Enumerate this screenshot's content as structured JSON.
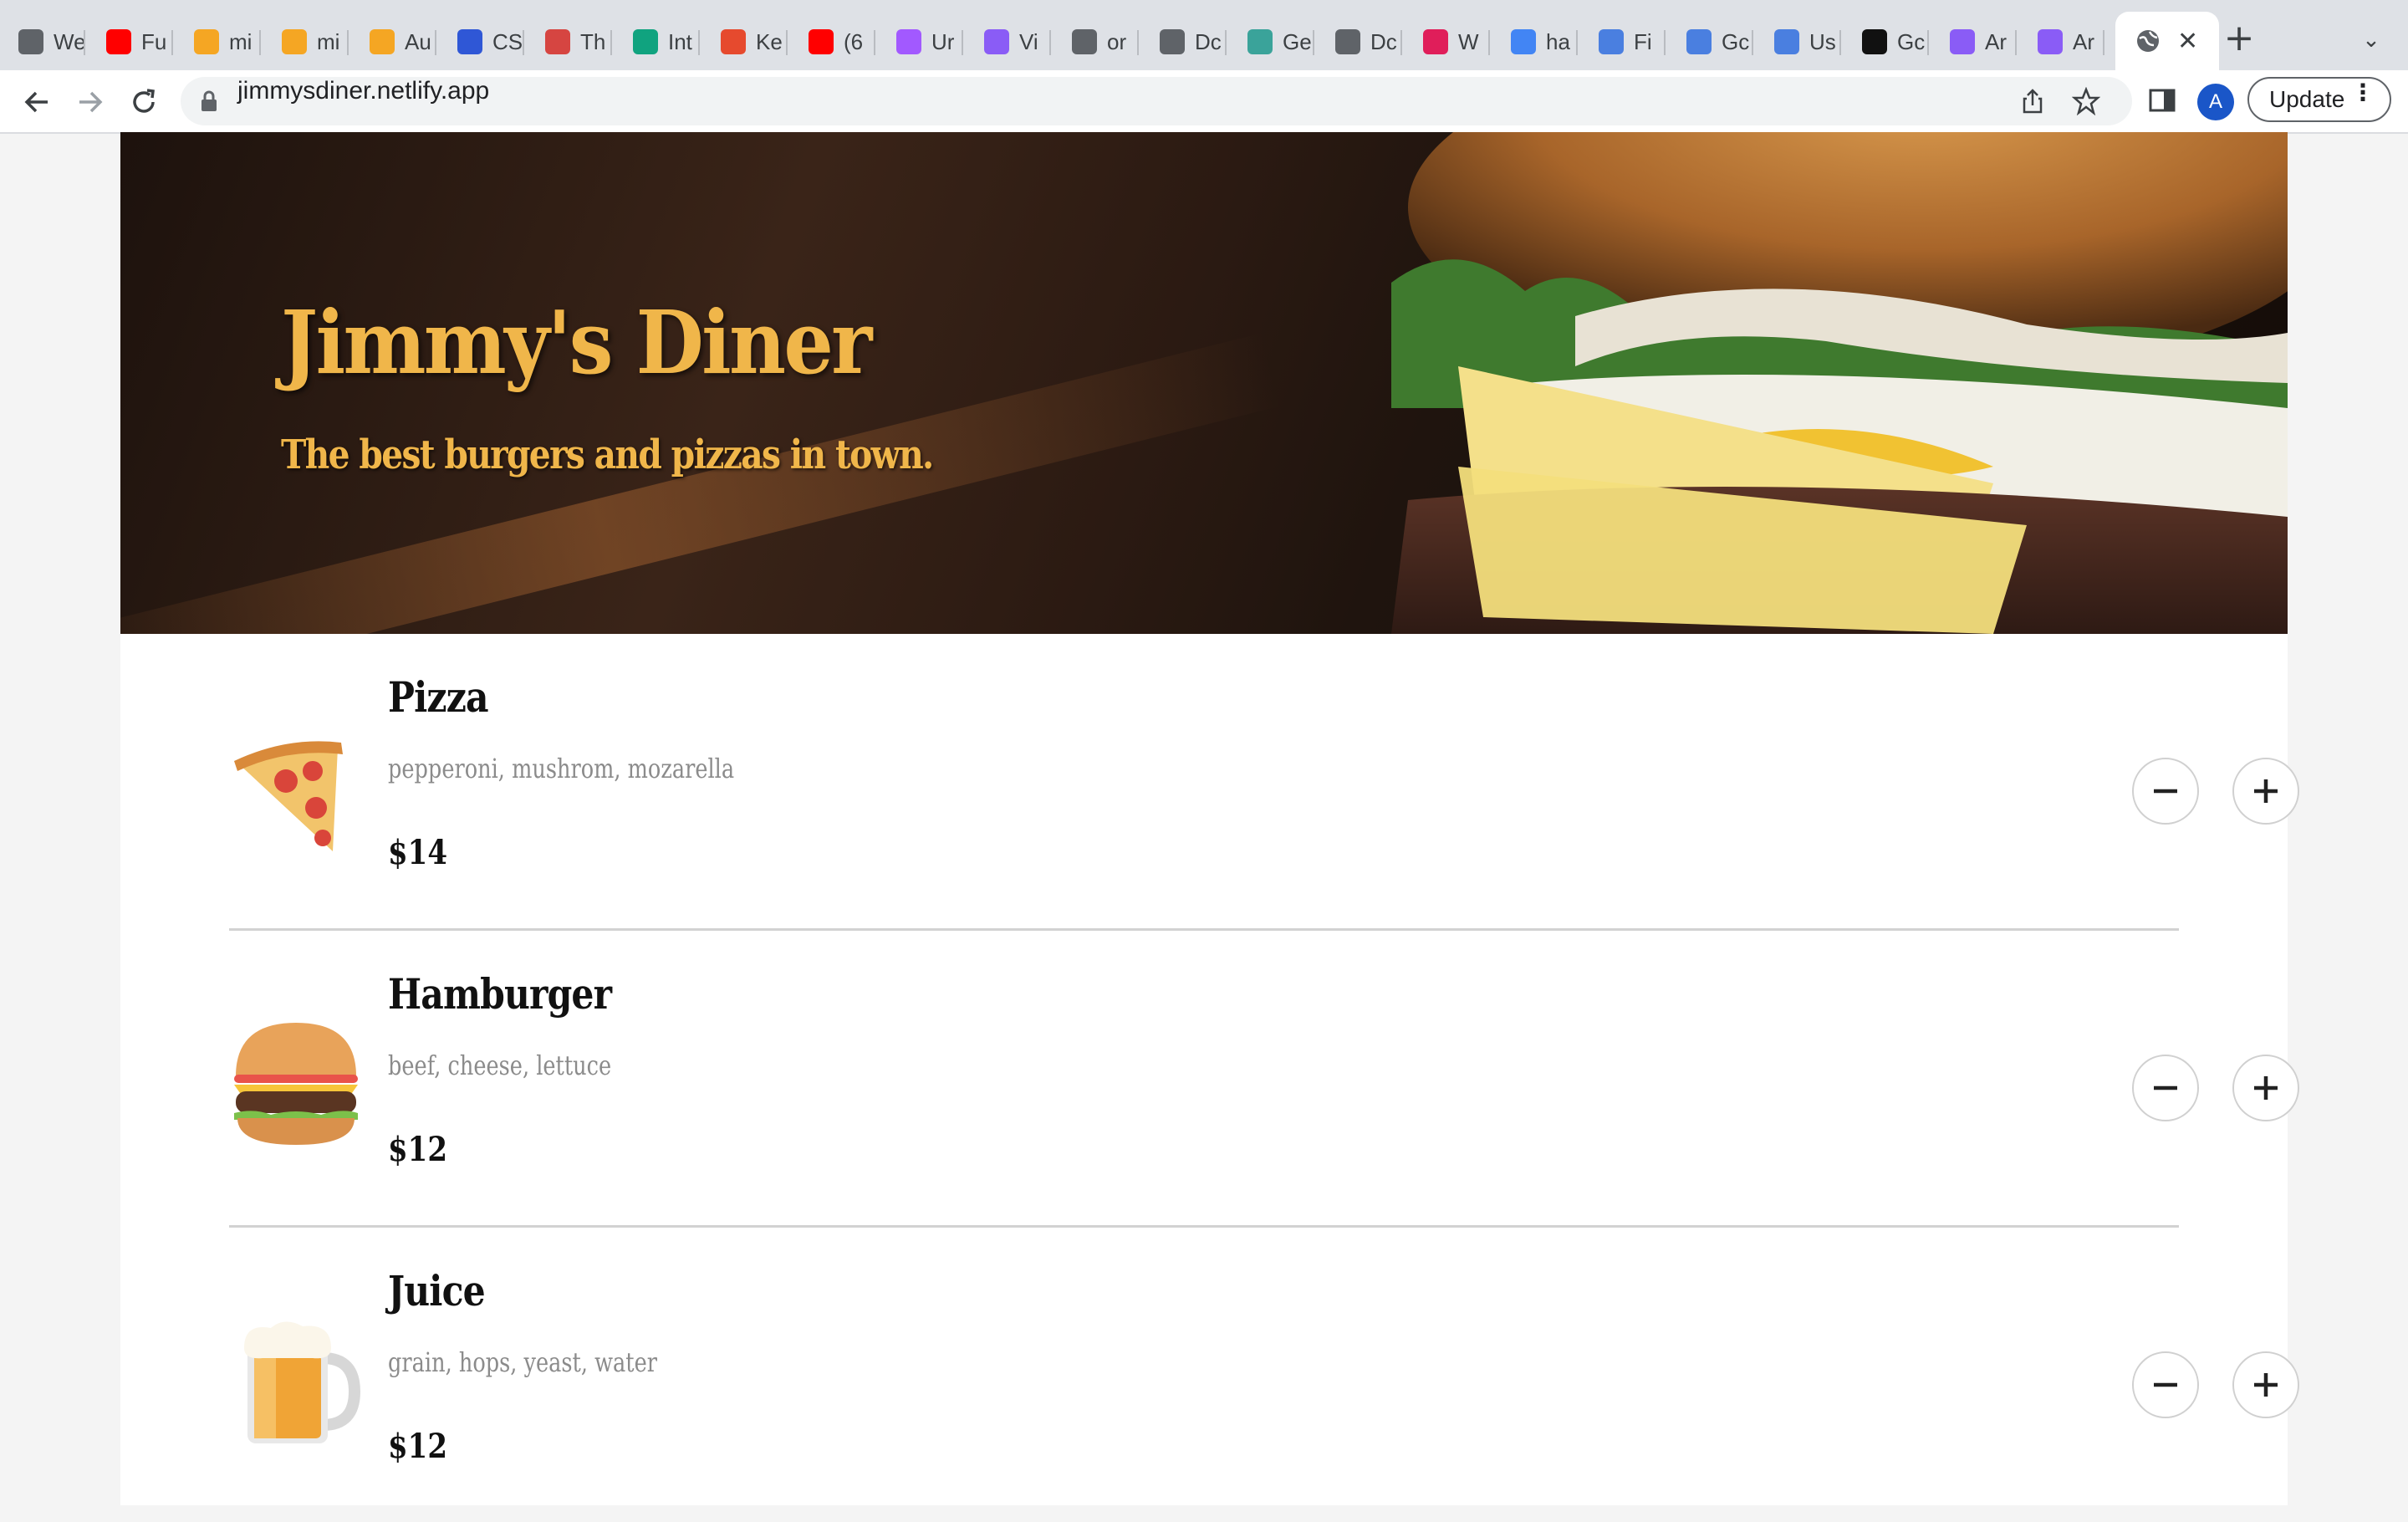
{
  "browser": {
    "tabs": [
      {
        "title": "We",
        "icon": "generic-page-icon",
        "color": "#5f6368"
      },
      {
        "title": "Fu",
        "icon": "youtube-icon",
        "color": "#ff0000"
      },
      {
        "title": "mi",
        "icon": "firebase-icon",
        "color": "#f5a623"
      },
      {
        "title": "mi",
        "icon": "firebase-icon",
        "color": "#f5a623"
      },
      {
        "title": "Au",
        "icon": "firebase-icon",
        "color": "#f5a623"
      },
      {
        "title": "CS",
        "icon": "css-grid-icon",
        "color": "#2f57d6"
      },
      {
        "title": "Th",
        "icon": "tower-icon",
        "color": "#d64541"
      },
      {
        "title": "Int",
        "icon": "openai-icon",
        "color": "#10a37f"
      },
      {
        "title": "Ke",
        "icon": "kp-icon",
        "color": "#e64a2e"
      },
      {
        "title": "(6",
        "icon": "youtube-icon",
        "color": "#ff0000"
      },
      {
        "title": "Ur",
        "icon": "figma-icon",
        "color": "#a259ff"
      },
      {
        "title": "Vi",
        "icon": "vite-icon",
        "color": "#8a5cf6"
      },
      {
        "title": "or",
        "icon": "globe-icon",
        "color": "#5f6368"
      },
      {
        "title": "Dc",
        "icon": "globe-icon",
        "color": "#5f6368"
      },
      {
        "title": "Ge",
        "icon": "diamond-icon",
        "color": "#3aa39a"
      },
      {
        "title": "Dc",
        "icon": "globe-icon",
        "color": "#5f6368"
      },
      {
        "title": "W",
        "icon": "slack-icon",
        "color": "#e01e5a"
      },
      {
        "title": "ha",
        "icon": "google-icon",
        "color": "#4285f4"
      },
      {
        "title": "Fi",
        "icon": "flag-icon",
        "color": "#4a7fe0"
      },
      {
        "title": "Gc",
        "icon": "flag-icon",
        "color": "#4a7fe0"
      },
      {
        "title": "Us",
        "icon": "flag-icon",
        "color": "#4a7fe0"
      },
      {
        "title": "Gc",
        "icon": "flag-dark-icon",
        "color": "#111111"
      },
      {
        "title": "Ar",
        "icon": "vite-icon",
        "color": "#8a5cf6"
      },
      {
        "title": "Ar",
        "icon": "vite-icon",
        "color": "#8a5cf6"
      }
    ],
    "active_tab_icon": "globe-icon",
    "url": "jimmysdiner.netlify.app",
    "avatar_letter": "A",
    "update_label": "Update"
  },
  "hero": {
    "title": "Jimmy's Diner",
    "subtitle": "The best burgers and pizzas in town."
  },
  "menu": [
    {
      "name": "Pizza",
      "description": "pepperoni, mushrom, mozarella",
      "price": "$14",
      "icon": "pizza-icon"
    },
    {
      "name": "Hamburger",
      "description": "beef, cheese, lettuce",
      "price": "$12",
      "icon": "hamburger-icon"
    },
    {
      "name": "Juice",
      "description": "grain, hops, yeast, water",
      "price": "$12",
      "icon": "beer-mug-icon"
    }
  ],
  "colors": {
    "accent": "#f0b64a",
    "divider": "#d2d2d2",
    "description": "#8b8b8b"
  }
}
